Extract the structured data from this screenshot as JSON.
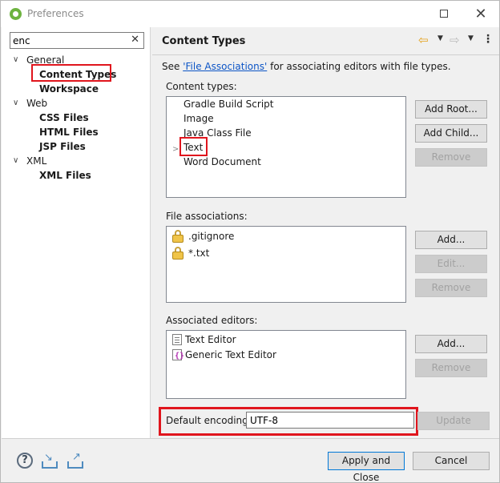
{
  "window": {
    "title": "Preferences",
    "maximize_icon": "maximize-icon",
    "close_glyph": "✕"
  },
  "sidebar": {
    "filter_value": "enc",
    "clear_glyph": "✕",
    "tree": [
      {
        "label": "General",
        "kind": "category"
      },
      {
        "label": "Content Types",
        "kind": "leaf",
        "selected": true
      },
      {
        "label": "Workspace",
        "kind": "leaf"
      },
      {
        "label": "Web",
        "kind": "category"
      },
      {
        "label": "CSS Files",
        "kind": "leaf"
      },
      {
        "label": "HTML Files",
        "kind": "leaf"
      },
      {
        "label": "JSP Files",
        "kind": "leaf"
      },
      {
        "label": "XML",
        "kind": "category"
      },
      {
        "label": "XML Files",
        "kind": "leaf"
      }
    ]
  },
  "page": {
    "title": "Content Types",
    "see_prefix": "See ",
    "see_link": "'File Associations'",
    "see_suffix": " for associating editors with file types.",
    "content_types_label": "Content types:",
    "content_types": [
      "Gradle Build Script",
      "Image",
      "Java Class File",
      "Text",
      "Word Document"
    ],
    "content_buttons": {
      "add_root": "Add Root...",
      "add_child": "Add Child...",
      "remove": "Remove"
    },
    "file_assoc_label": "File associations:",
    "file_associations": [
      ".gitignore",
      "*.txt"
    ],
    "file_assoc_buttons": {
      "add": "Add...",
      "edit": "Edit...",
      "remove": "Remove"
    },
    "editors_label": "Associated editors:",
    "editors": [
      "Text Editor",
      "Generic Text Editor"
    ],
    "editor_buttons": {
      "add": "Add...",
      "remove": "Remove"
    },
    "encoding_label": "Default encoding:",
    "encoding_value": "UTF-8",
    "update_button": "Update"
  },
  "footer": {
    "help_glyph": "?",
    "apply_close": "Apply and Close",
    "cancel": "Cancel"
  },
  "colors": {
    "highlight": "#e0151d",
    "link": "#0b54c6",
    "accent": "#0078d7"
  }
}
